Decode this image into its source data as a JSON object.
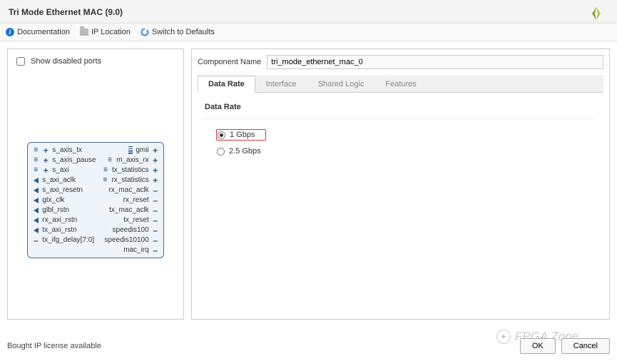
{
  "title": "Tri Mode Ethernet MAC (9.0)",
  "toolbar": {
    "documentation": "Documentation",
    "ip_location": "IP Location",
    "switch_defaults": "Switch to Defaults"
  },
  "left": {
    "show_disabled_label": "Show disabled ports",
    "ports_left": [
      {
        "pin": "plus",
        "label": "s_axis_tx",
        "pre": "bus"
      },
      {
        "pin": "plus",
        "label": "s_axis_pause",
        "pre": "bus"
      },
      {
        "pin": "plus",
        "label": "s_axi",
        "pre": "bus"
      },
      {
        "pin": "tri-r",
        "label": "s_axi_aclk"
      },
      {
        "pin": "tri-r",
        "label": "s_axi_resetn"
      },
      {
        "pin": "tri-r",
        "label": "gtx_clk"
      },
      {
        "pin": "tri-r",
        "label": "glbl_rstn"
      },
      {
        "pin": "tri-r",
        "label": "rx_axi_rstn"
      },
      {
        "pin": "tri-r",
        "label": "tx_axi_rstn"
      },
      {
        "pin": "dash",
        "label": "tx_ifg_delay[7:0]"
      }
    ],
    "ports_right": [
      {
        "pin": "plus",
        "label": "gmii",
        "post": "stack"
      },
      {
        "pin": "plus",
        "label": "m_axis_rx",
        "post": "bus"
      },
      {
        "pin": "plus",
        "label": "tx_statistics",
        "post": "bus"
      },
      {
        "pin": "plus",
        "label": "rx_statistics",
        "post": "bus"
      },
      {
        "pin": "dash",
        "label": "rx_mac_aclk"
      },
      {
        "pin": "dash",
        "label": "rx_reset"
      },
      {
        "pin": "dash",
        "label": "tx_mac_aclk"
      },
      {
        "pin": "dash",
        "label": "tx_reset"
      },
      {
        "pin": "dash",
        "label": "speedis100"
      },
      {
        "pin": "dash",
        "label": "speedis10100"
      },
      {
        "pin": "dash",
        "label": "mac_irq"
      }
    ]
  },
  "right": {
    "component_name_label": "Component Name",
    "component_name_value": "tri_mode_ethernet_mac_0",
    "tabs": [
      "Data Rate",
      "Interface",
      "Shared Logic",
      "Features"
    ],
    "active_tab": 0,
    "section_label": "Data Rate",
    "options": [
      {
        "label": "1 Gbps",
        "selected": true,
        "highlight": true
      },
      {
        "label": "2.5 Gbps",
        "selected": false,
        "highlight": false
      }
    ]
  },
  "footer": {
    "status": "Bought IP license available",
    "ok": "OK",
    "cancel": "Cancel"
  },
  "watermark": "FPGA Zone"
}
